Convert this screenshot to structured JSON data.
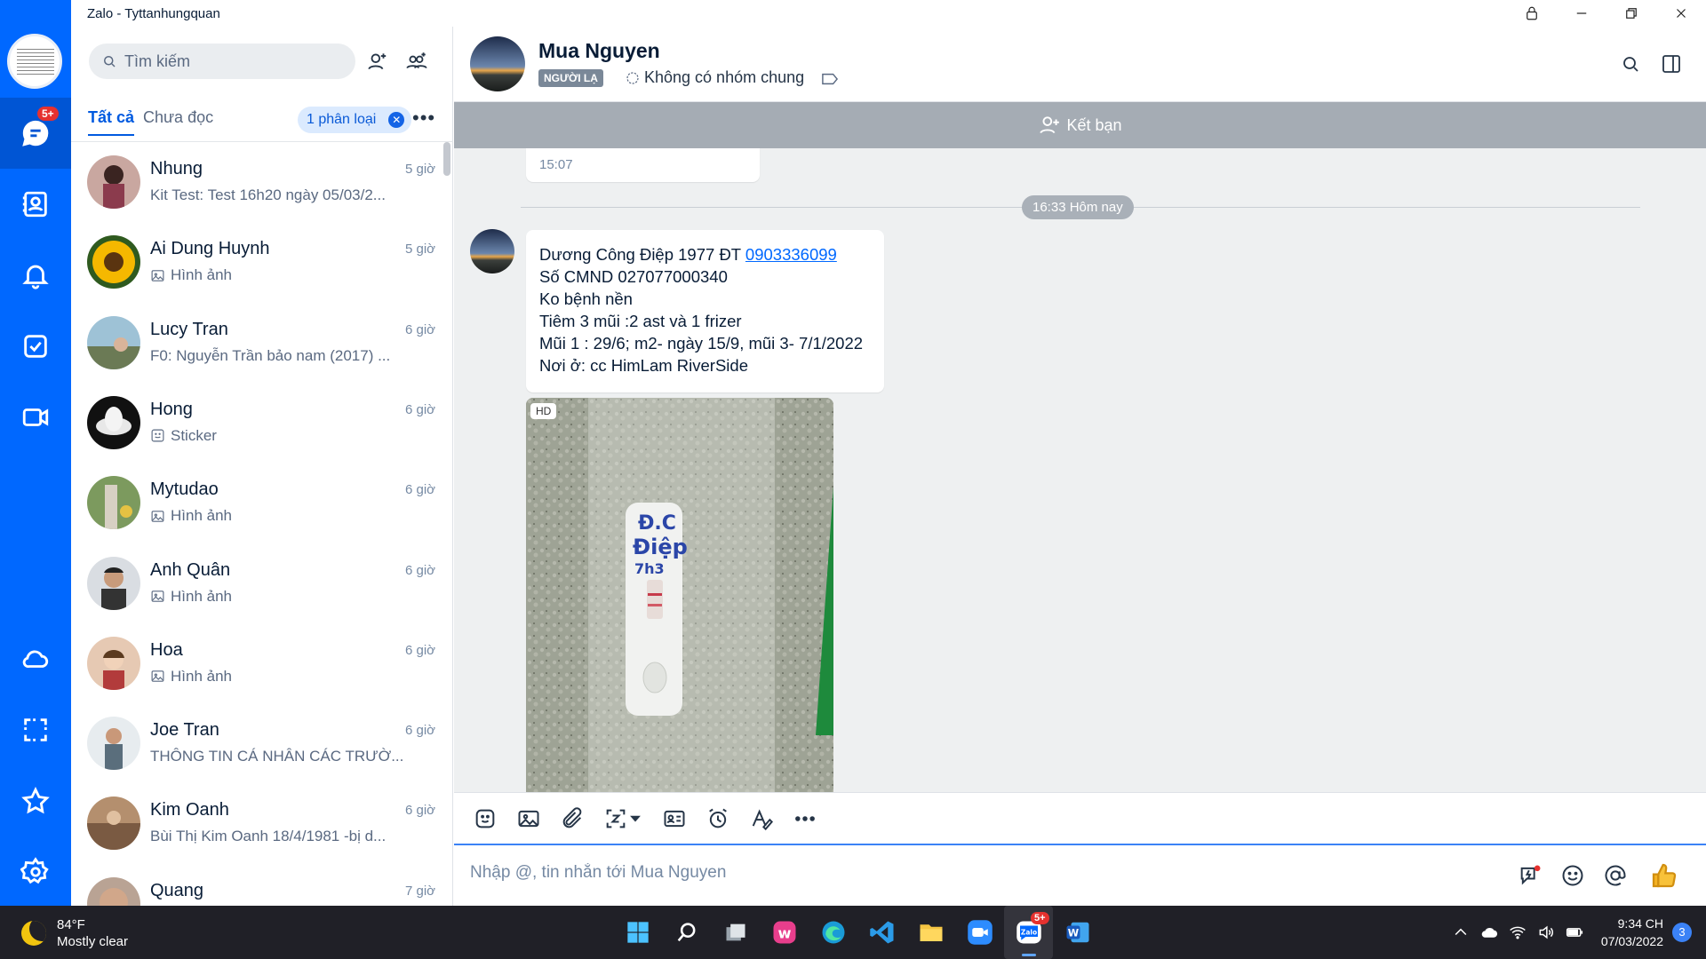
{
  "window": {
    "title": "Zalo - Tyttanhungquan"
  },
  "nav": {
    "messages_badge": "5+"
  },
  "convlist": {
    "search_placeholder": "Tìm kiếm",
    "tabs": {
      "all": "Tất cả",
      "unread": "Chưa đọc"
    },
    "filter_chip": "1 phân loại",
    "items": [
      {
        "name": "Nhung",
        "time": "5 giờ",
        "preview": "Kit Test: Test 16h20 ngày 05/03/2...",
        "preview_icon": ""
      },
      {
        "name": "Ai Dung Huynh",
        "time": "5 giờ",
        "preview": "Hình ảnh",
        "preview_icon": "image-icon"
      },
      {
        "name": "Lucy Tran",
        "time": "6 giờ",
        "preview": "F0: Nguyễn Trần bảo nam (2017) ...",
        "preview_icon": ""
      },
      {
        "name": "Hong",
        "time": "6 giờ",
        "preview": "Sticker",
        "preview_icon": "sticker-icon"
      },
      {
        "name": "Mytudao",
        "time": "6 giờ",
        "preview": "Hình ảnh",
        "preview_icon": "image-icon"
      },
      {
        "name": "Anh Quân",
        "time": "6 giờ",
        "preview": "Hình ảnh",
        "preview_icon": "image-icon"
      },
      {
        "name": "Hoa",
        "time": "6 giờ",
        "preview": "Hình ảnh",
        "preview_icon": "image-icon"
      },
      {
        "name": "Joe Tran",
        "time": "6 giờ",
        "preview": "THÔNG TIN CÁ NHÂN CÁC TRƯỜ...",
        "preview_icon": ""
      },
      {
        "name": "Kim Oanh",
        "time": "6 giờ",
        "preview": "Bùi Thị Kim Oanh 18/4/1981 -bị d...",
        "preview_icon": ""
      },
      {
        "name": "Quang",
        "time": "7 giờ",
        "preview": "",
        "preview_icon": ""
      }
    ]
  },
  "chat": {
    "contact_name": "Mua Nguyen",
    "stranger_label": "NGƯỜI LẠ",
    "no_group_label": "Không có nhóm chung",
    "add_friend_label": "Kết bạn",
    "prev_message_time": "15:07",
    "date_separator": "16:33 Hôm nay",
    "message": {
      "line1_prefix": "Dương Công Điệp 1977 ĐT ",
      "phone": "0903336099",
      "line2": "Số CMND 027077000340",
      "line3": "Ko bệnh nền",
      "line4": "Tiêm 3 mũi :2 ast và 1 frizer",
      "line5": "Mũi 1 : 29/6; m2- ngày 15/9, mũi 3- 7/1/2022",
      "line6": "Nơi ở: cc HimLam RiverSide"
    },
    "photo_badge": "HD",
    "photo_note_1": "Đ.C",
    "photo_note_2": "Điệp",
    "photo_note_3": "7h3",
    "input_placeholder": "Nhập @, tin nhắn tới Mua Nguyen"
  },
  "taskbar": {
    "temperature": "84°F",
    "weather": "Mostly clear",
    "zalo_badge": "5+",
    "time": "9:34 CH",
    "date": "07/03/2022",
    "notification_count": "3"
  }
}
